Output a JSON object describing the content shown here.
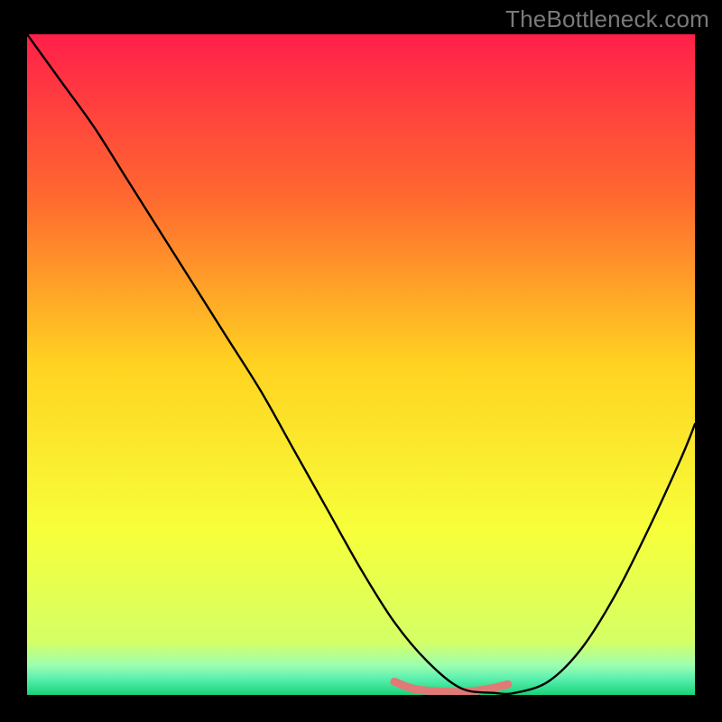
{
  "attribution": "TheBottleneck.com",
  "chart_data": {
    "type": "line",
    "title": "",
    "xlabel": "",
    "ylabel": "",
    "xlim": [
      0,
      100
    ],
    "ylim": [
      0,
      100
    ],
    "grid": false,
    "legend": false,
    "gradient_stops": [
      {
        "offset": 0.0,
        "color": "#ff1f4a"
      },
      {
        "offset": 0.25,
        "color": "#ff6a2f"
      },
      {
        "offset": 0.5,
        "color": "#ffd321"
      },
      {
        "offset": 0.75,
        "color": "#f7ff3a"
      },
      {
        "offset": 0.92,
        "color": "#d4ff66"
      },
      {
        "offset": 0.955,
        "color": "#9dffb0"
      },
      {
        "offset": 0.975,
        "color": "#5cf0af"
      },
      {
        "offset": 1.0,
        "color": "#17d37a"
      }
    ],
    "series": [
      {
        "name": "curve",
        "stroke": "#000000",
        "x": [
          0,
          5,
          10,
          15,
          20,
          25,
          30,
          35,
          40,
          45,
          50,
          55,
          60,
          65,
          70,
          73,
          78,
          83,
          88,
          93,
          98,
          100
        ],
        "values": [
          100,
          93,
          86,
          78,
          70,
          62,
          54,
          46,
          37,
          28,
          19,
          11,
          5,
          1,
          0.3,
          0.3,
          2,
          7,
          15,
          25,
          36,
          41
        ]
      }
    ],
    "highlight_segment": {
      "stroke": "#e07a76",
      "width": 9,
      "linecap": "round",
      "x": [
        55,
        58,
        62,
        66,
        69,
        72
      ],
      "values": [
        2.0,
        0.9,
        0.5,
        0.5,
        0.9,
        1.6
      ]
    }
  }
}
